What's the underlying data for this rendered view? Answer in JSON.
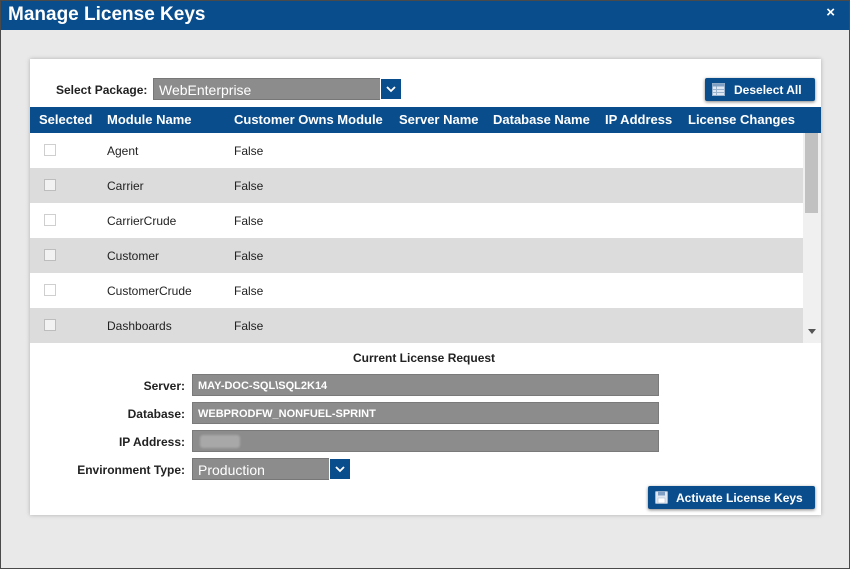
{
  "window": {
    "title": "Manage License Keys",
    "close_glyph": "×"
  },
  "package": {
    "label": "Select Package:",
    "value": "WebEnterprise"
  },
  "buttons": {
    "deselect_all": "Deselect All",
    "activate": "Activate License Keys"
  },
  "table": {
    "columns": [
      "Selected",
      "Module Name",
      "Customer Owns Module",
      "Server Name",
      "Database Name",
      "IP Address",
      "License Changes"
    ],
    "rows": [
      {
        "module": "Agent",
        "owns": "False",
        "selected": false
      },
      {
        "module": "Carrier",
        "owns": "False",
        "selected": false
      },
      {
        "module": "CarrierCrude",
        "owns": "False",
        "selected": false
      },
      {
        "module": "Customer",
        "owns": "False",
        "selected": false
      },
      {
        "module": "CustomerCrude",
        "owns": "False",
        "selected": false
      },
      {
        "module": "Dashboards",
        "owns": "False",
        "selected": false
      }
    ]
  },
  "request": {
    "title": "Current License Request",
    "server_label": "Server:",
    "server": "MAY-DOC-SQL\\SQL2K14",
    "database_label": "Database:",
    "database": "WEBPRODFW_NONFUEL-SPRINT",
    "ip_label": "IP Address:",
    "ip": "",
    "env_label": "Environment Type:",
    "env": "Production"
  },
  "icons": {
    "close": "close-icon",
    "dropdown": "chevron-down-icon",
    "deselect": "grid-icon",
    "activate": "save-icon",
    "scroll_down": "arrow-down-icon"
  },
  "colors": {
    "accent": "#0a4d8c",
    "field_bg": "#8c8c8c",
    "row_alt": "#dcdcdc"
  }
}
